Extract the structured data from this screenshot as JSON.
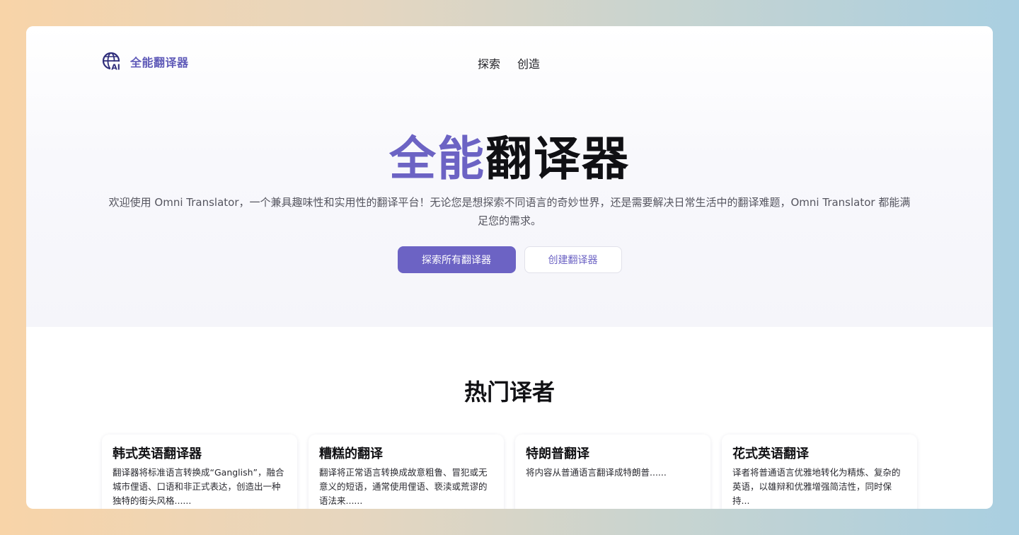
{
  "app": {
    "logo_text": "全能翻译器",
    "logo_icon": "globe-ai-icon",
    "brand_color": "#6c63c4"
  },
  "nav": {
    "items": [
      {
        "label": "探索"
      },
      {
        "label": "创造"
      }
    ]
  },
  "hero": {
    "title_accent": "全能",
    "title_rest": "翻译器",
    "description": "欢迎使用 Omni Translator，一个兼具趣味性和实用性的翻译平台！无论您是想探索不同语言的奇妙世界，还是需要解决日常生活中的翻译难题，Omni Translator 都能满足您的需求。",
    "primary_button": "探索所有翻译器",
    "secondary_button": "创建翻译器"
  },
  "popular": {
    "title": "热门译者",
    "cards": [
      {
        "title": "韩式英语翻译器",
        "desc": "翻译器将标准语言转换成“Ganglish”，融合城市俚语、口语和非正式表达，创造出一种独特的街头风格......"
      },
      {
        "title": "糟糕的翻译",
        "desc": "翻译将正常语言转换成故意粗鲁、冒犯或无意义的短语，通常使用俚语、亵渎或荒谬的语法来......"
      },
      {
        "title": "特朗普翻译",
        "desc": "将内容从普通语言翻译成特朗普......"
      },
      {
        "title": "花式英语翻译",
        "desc": "译者将普通语言优雅地转化为精炼、复杂的英语，以雄辩和优雅增强简洁性，同时保持..."
      }
    ]
  }
}
